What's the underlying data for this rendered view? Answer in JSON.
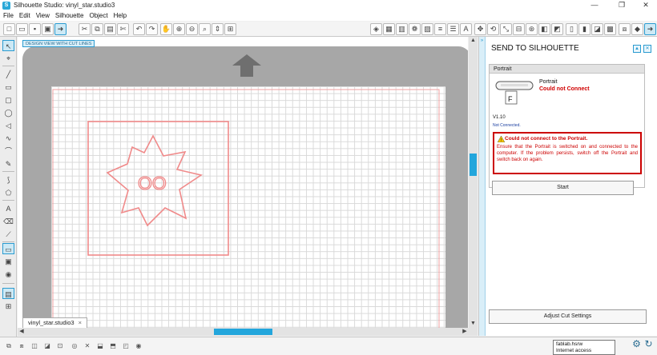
{
  "window": {
    "title": "Silhouette Studio: vinyl_star.studio3",
    "minimize": "—",
    "maximize": "❐",
    "close": "✕"
  },
  "menu": [
    "File",
    "Edit",
    "View",
    "Silhouette",
    "Object",
    "Help"
  ],
  "canvas": {
    "view_label": "DESIGN VIEW WITH CUT LINES",
    "doc_tab": "vinyl_star.studio3",
    "doc_tab_close": "×",
    "star_text": "OO"
  },
  "panel": {
    "title": "SEND TO SILHOUETTE",
    "device_header": "Portrait",
    "device_name": "Portrait",
    "device_status": "Could not Connect",
    "version": "V1.10",
    "connection": "Not Connected.",
    "error_title": "Could not connect to the Portrait.",
    "error_text": "Ensure that the Portrait is switched on and connected to the computer. If the problem persists, switch off the Portrait and switch back on again.",
    "start_label": "Start",
    "adjust_label": "Adjust Cut Settings"
  },
  "status": {
    "tooltip_line1": "fablab.hsrw",
    "tooltip_line2": "Internet access"
  },
  "colors": {
    "accent": "#23a6dc",
    "cut_line": "#f08a8a",
    "error": "#cc0000"
  }
}
